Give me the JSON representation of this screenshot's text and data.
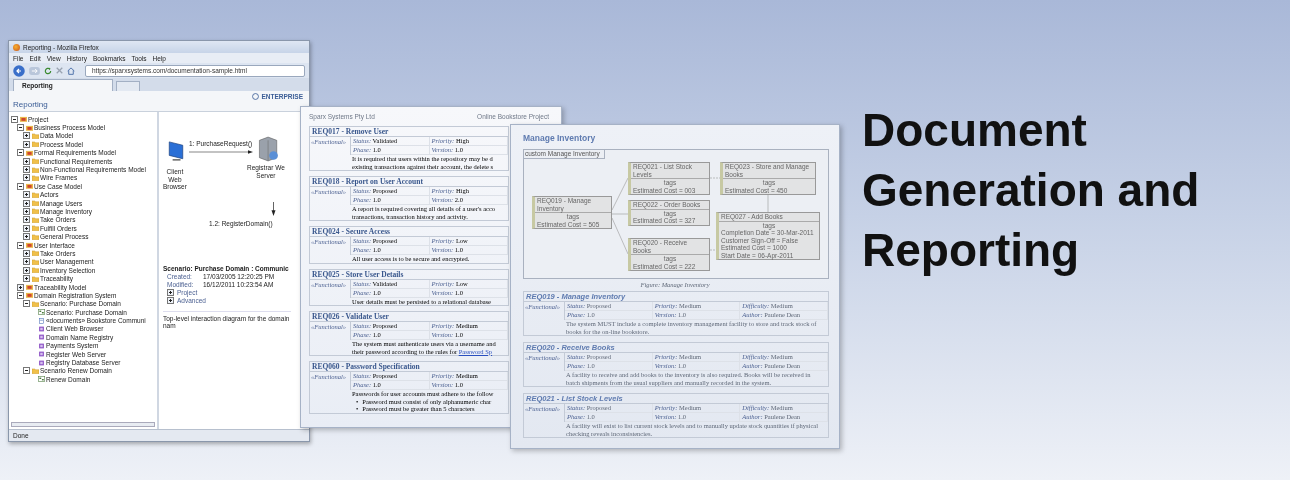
{
  "browser": {
    "title": "Reporting - Mozilla Firefox",
    "menu": [
      "File",
      "Edit",
      "View",
      "History",
      "Bookmarks",
      "Tools",
      "Help"
    ],
    "url": "https://sparxsystems.com/documentation-sample.html",
    "tab": "Reporting",
    "logo": "ENTERPRISE",
    "page_title": "Reporting",
    "tree": [
      {
        "label": "Project",
        "kind": "package",
        "expanded": true,
        "children": [
          {
            "label": "Business Process Model",
            "kind": "package",
            "expanded": true,
            "children": [
              {
                "label": "Data Model",
                "kind": "folder",
                "expanded": false
              },
              {
                "label": "Process Model",
                "kind": "folder",
                "expanded": false
              }
            ]
          },
          {
            "label": "Formal Requirements Model",
            "kind": "package",
            "expanded": true,
            "children": [
              {
                "label": "Functional Requirements",
                "kind": "folder",
                "expanded": false
              },
              {
                "label": "Non-Functional Requirements Model",
                "kind": "folder",
                "expanded": false
              },
              {
                "label": "Wire Frames",
                "kind": "folder",
                "expanded": false
              }
            ]
          },
          {
            "label": "Use Case Model",
            "kind": "package",
            "expanded": true,
            "children": [
              {
                "label": "Actors",
                "kind": "folder",
                "expanded": false
              },
              {
                "label": "Manage Users",
                "kind": "folder",
                "expanded": false
              },
              {
                "label": "Manage Inventory",
                "kind": "folder",
                "expanded": false
              },
              {
                "label": "Take Orders",
                "kind": "folder",
                "expanded": false
              },
              {
                "label": "Fulfill Orders",
                "kind": "folder",
                "expanded": false
              },
              {
                "label": "General Process",
                "kind": "folder",
                "expanded": false
              }
            ]
          },
          {
            "label": "User Interface",
            "kind": "package",
            "expanded": true,
            "children": [
              {
                "label": "Take Orders",
                "kind": "folder",
                "expanded": false
              },
              {
                "label": "User Management",
                "kind": "folder",
                "expanded": false
              },
              {
                "label": "Inventory Selection",
                "kind": "folder",
                "expanded": false
              },
              {
                "label": "Traceability",
                "kind": "folder",
                "expanded": false
              }
            ]
          },
          {
            "label": "Traceability Model",
            "kind": "package",
            "expanded": false
          },
          {
            "label": "Domain Registration System",
            "kind": "package",
            "expanded": true,
            "children": [
              {
                "label": "Scenario: Purchase Domain",
                "kind": "folder",
                "expanded": true,
                "children": [
                  {
                    "label": "Scenario: Purchase Domain",
                    "kind": "diagram"
                  },
                  {
                    "label": "«documents» Bookstore Communi",
                    "kind": "document"
                  },
                  {
                    "label": "Client Web Browser",
                    "kind": "element"
                  },
                  {
                    "label": "Domain Name Registry",
                    "kind": "element"
                  },
                  {
                    "label": "Payments System",
                    "kind": "element"
                  },
                  {
                    "label": "Register Web Server",
                    "kind": "element"
                  },
                  {
                    "label": "Registry Database Server",
                    "kind": "element"
                  }
                ]
              },
              {
                "label": "Scenario Renew Domain",
                "kind": "folder",
                "expanded": true,
                "children": [
                  {
                    "label": "Renew Domain",
                    "kind": "diagram"
                  }
                ]
              }
            ]
          }
        ]
      }
    ],
    "diagram": {
      "client": [
        "Client",
        "Web",
        "Browser"
      ],
      "message": "1: PurchaseRequest()",
      "server": [
        "Registrar We",
        "Server"
      ],
      "reply": "1.2: RegisterDomain()"
    },
    "details": {
      "heading": "Scenario: Purchase Domain : Communic",
      "props": [
        [
          "Created:",
          "17/03/2005 12:20:25 PM"
        ],
        [
          "Modified:",
          "16/12/2011 10:23:54 AM"
        ]
      ],
      "sections": [
        "Project",
        "Advanced"
      ],
      "notes": "Top-level interaction diagram for the domain nam"
    },
    "status": "Done"
  },
  "doc_left": {
    "company": "Sparx Systems Pty Ltd",
    "project": "Online Bookstore Project",
    "requirements": [
      {
        "title": "REQ017 - Remove User",
        "stereotype": "«Functional»",
        "fields": [
          [
            "Status:",
            "Validated"
          ],
          [
            "Priority:",
            "High"
          ],
          [
            "Phase:",
            "1.0"
          ],
          [
            "Version:",
            "1.0"
          ]
        ],
        "lines": [
          "It is required that users within the repository may be d",
          "existing transactions against their account, the delete s"
        ]
      },
      {
        "title": "REQ018 - Report on User Account",
        "stereotype": "«Functional»",
        "fields": [
          [
            "Status:",
            "Proposed"
          ],
          [
            "Priority:",
            "High"
          ],
          [
            "Phase:",
            "1.0"
          ],
          [
            "Version:",
            "2.0"
          ]
        ],
        "lines": [
          "A report is required covering all details of a user's acco",
          "transactions, transaction history and activity."
        ]
      },
      {
        "title": "REQ024 - Secure Access",
        "stereotype": "«Functional»",
        "fields": [
          [
            "Status:",
            "Proposed"
          ],
          [
            "Priority:",
            "Low"
          ],
          [
            "Phase:",
            "1.0"
          ],
          [
            "Version:",
            "1.0"
          ]
        ],
        "lines": [
          "All user access is to be secure and encrypted."
        ]
      },
      {
        "title": "REQ025 - Store User Details",
        "stereotype": "«Functional»",
        "fields": [
          [
            "Status:",
            "Validated"
          ],
          [
            "Priority:",
            "Low"
          ],
          [
            "Phase:",
            "1.0"
          ],
          [
            "Version:",
            "1.0"
          ]
        ],
        "lines": [
          "User details must be persisted to a relational database"
        ]
      },
      {
        "title": "REQ026 - Validate User",
        "stereotype": "«Functional»",
        "fields": [
          [
            "Status:",
            "Proposed"
          ],
          [
            "Priority:",
            "Medium"
          ],
          [
            "Phase:",
            "1.0"
          ],
          [
            "Version:",
            "1.0"
          ]
        ],
        "lines": [
          "The system must authenticate users via a username and"
        ],
        "link_line": {
          "text": "their password according to the rules for",
          "link": "Password Sp"
        }
      },
      {
        "title": "REQ060 - Password Specification",
        "stereotype": "«Functional»",
        "fields": [
          [
            "Status:",
            "Proposed"
          ],
          [
            "Priority:",
            "Medium"
          ],
          [
            "Phase:",
            "1.0"
          ],
          [
            "Version:",
            "1.0"
          ]
        ],
        "lines": [
          "Passwords for user accounts must adhere to the follow"
        ],
        "bullet": "•",
        "bullets": [
          "Password must consist of only alphanumeric char",
          "Password must be greater than 5 characters"
        ]
      }
    ]
  },
  "doc_right": {
    "title": "Manage Inventory",
    "frame_label": "custom Manage Inventory",
    "nodes": [
      {
        "title": "REQ019 - Manage Inventory",
        "tags": [
          "Estimated Cost = 505"
        ],
        "compartment": "tags"
      },
      {
        "title": "REQ021 - List Stock Levels",
        "tags": [
          "Estimated Cost = 003"
        ],
        "compartment": "tags"
      },
      {
        "title": "REQ022 - Order Books",
        "tags": [
          "Estimated Cost = 327"
        ],
        "compartment": "tags"
      },
      {
        "title": "REQ020 - Receive Books",
        "tags": [
          "Estimated Cost = 222"
        ],
        "compartment": "tags"
      },
      {
        "title": "REQ023 - Store and Manage Books",
        "tags": [
          "Estimated Cost = 450"
        ],
        "compartment": "tags"
      },
      {
        "title": "REQ027 - Add Books",
        "tags": [
          "Completion Date = 30-Mar-2011",
          "Customer Sign-Off = False",
          "Estimated Cost = 1000",
          "Start Date = 06-Apr-2011"
        ],
        "compartment": "tags"
      }
    ],
    "caption": "Figure: Manage Inventory",
    "requirements": [
      {
        "title": "REQ019 - Manage Inventory",
        "stereotype": "«Functional»",
        "fields": [
          [
            "Status:",
            "Proposed"
          ],
          [
            "Priority:",
            "Medium"
          ],
          [
            "Difficulty:",
            "Medium"
          ],
          [
            "Phase:",
            "1.0"
          ],
          [
            "Version:",
            "1.0"
          ],
          [
            "Author:",
            "Paulene Dean"
          ]
        ],
        "text": "The system MUST include a complete inventory management facility to store and track stock of books for the on-line bookstore."
      },
      {
        "title": "REQ020 - Receive Books",
        "stereotype": "«Functional»",
        "fields": [
          [
            "Status:",
            "Proposed"
          ],
          [
            "Priority:",
            "Medium"
          ],
          [
            "Difficulty:",
            "Medium"
          ],
          [
            "Phase:",
            "1.0"
          ],
          [
            "Version:",
            "1.0"
          ],
          [
            "Author:",
            "Paulene Dean"
          ]
        ],
        "text": "A facility to receive and add books to the inventory is also required. Books will be received in batch shipments from the usual suppliers and manually recorded in the system."
      },
      {
        "title": "REQ021 - List Stock Levels",
        "stereotype": "«Functional»",
        "fields": [
          [
            "Status:",
            "Proposed"
          ],
          [
            "Priority:",
            "Medium"
          ],
          [
            "Difficulty:",
            "Medium"
          ],
          [
            "Phase:",
            "1.0"
          ],
          [
            "Version:",
            "1.0"
          ],
          [
            "Author:",
            "Paulene Dean"
          ]
        ],
        "text": "A facility will exist to list current stock levels and to manually update stock quantities if physical checking reveals inconsistencies."
      }
    ]
  },
  "headline": [
    "Document",
    "Generation and",
    "Reporting"
  ]
}
